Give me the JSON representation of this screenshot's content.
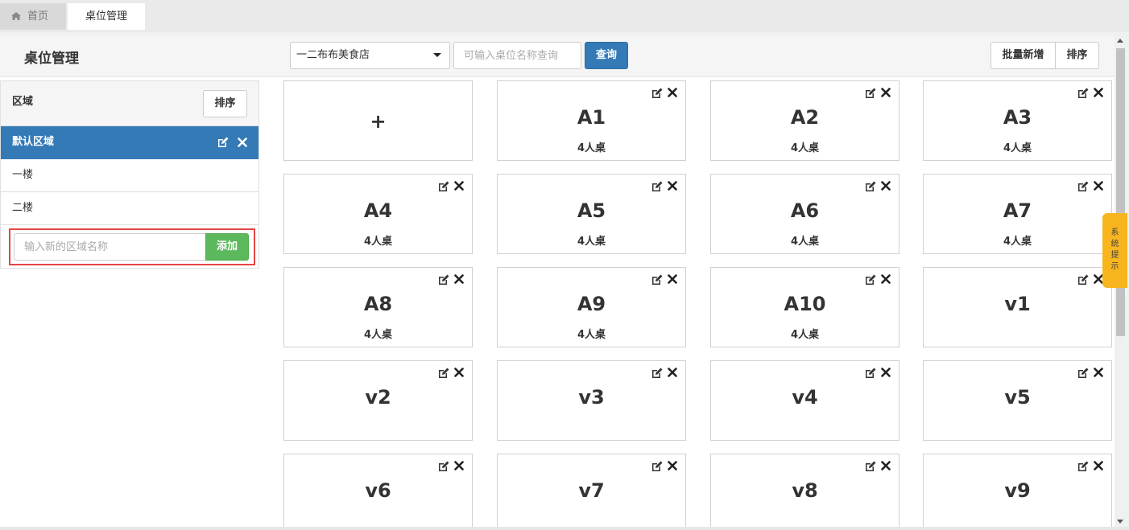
{
  "tabs": [
    {
      "label": "首页",
      "icon": "home-icon"
    },
    {
      "label": "桌位管理"
    }
  ],
  "header": {
    "title": "桌位管理",
    "store_selected": "一二布布美食店",
    "search_placeholder": "可输入桌位名称查询",
    "query_label": "查询",
    "batch_add_label": "批量新增",
    "sort_label": "排序"
  },
  "areas": {
    "title": "区域",
    "sort_label": "排序",
    "items": [
      {
        "label": "默认区域",
        "active": true
      },
      {
        "label": "一楼"
      },
      {
        "label": "二楼"
      }
    ],
    "add_placeholder": "输入新的区域名称",
    "add_label": "添加"
  },
  "tables": {
    "add_symbol": "+",
    "items": [
      {
        "name": "A1",
        "seat": "4人桌"
      },
      {
        "name": "A2",
        "seat": "4人桌"
      },
      {
        "name": "A3",
        "seat": "4人桌"
      },
      {
        "name": "A4",
        "seat": "4人桌"
      },
      {
        "name": "A5",
        "seat": "4人桌"
      },
      {
        "name": "A6",
        "seat": "4人桌"
      },
      {
        "name": "A7",
        "seat": "4人桌"
      },
      {
        "name": "A8",
        "seat": "4人桌"
      },
      {
        "name": "A9",
        "seat": "4人桌"
      },
      {
        "name": "A10",
        "seat": "4人桌"
      },
      {
        "name": "v1",
        "seat": ""
      },
      {
        "name": "v2",
        "seat": ""
      },
      {
        "name": "v3",
        "seat": ""
      },
      {
        "name": "v4",
        "seat": ""
      },
      {
        "name": "v5",
        "seat": ""
      },
      {
        "name": "v6",
        "seat": ""
      },
      {
        "name": "v7",
        "seat": ""
      },
      {
        "name": "v8",
        "seat": ""
      },
      {
        "name": "v9",
        "seat": ""
      }
    ]
  },
  "side_tip": [
    "系",
    "统",
    "提",
    "示"
  ],
  "colors": {
    "primary": "#337ab7",
    "success": "#5cb85c",
    "highlight_border": "#e64545",
    "tip": "#f8b51d"
  }
}
